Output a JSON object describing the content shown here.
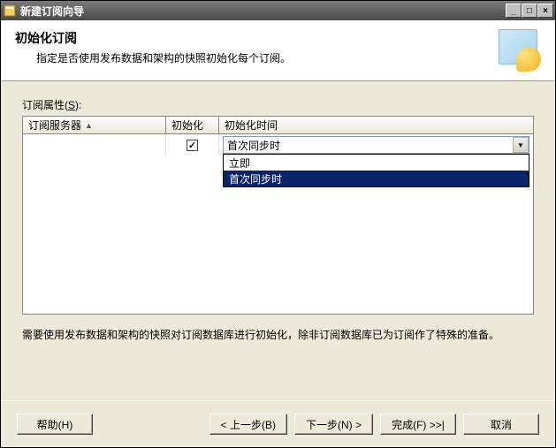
{
  "window": {
    "title": "新建订阅向导"
  },
  "header": {
    "title": "初始化订阅",
    "subtitle": "指定是否使用发布数据和架构的快照初始化每个订阅。"
  },
  "group_label_pre": "订阅属性(",
  "group_label_key": "S",
  "group_label_post": "):",
  "table": {
    "headers": {
      "server": "订阅服务器",
      "init": "初始化",
      "time": "初始化时间"
    },
    "row": {
      "server": "",
      "checked": "✓",
      "selected": "首次同步时"
    },
    "dropdown_options": [
      {
        "label": "立即",
        "selected": false
      },
      {
        "label": "首次同步时",
        "selected": true
      }
    ]
  },
  "note": "需要使用发布数据和架构的快照对订阅数据库进行初始化，除非订阅数据库已为订阅作了特殊的准备。",
  "buttons": {
    "help": "帮助(H)",
    "back": "< 上一步(B)",
    "next": "下一步(N) >",
    "finish": "完成(F) >>|",
    "cancel": "取消"
  }
}
